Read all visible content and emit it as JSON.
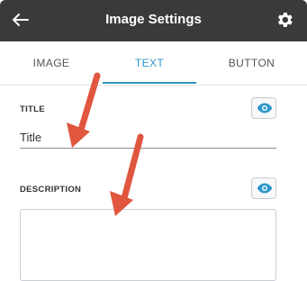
{
  "header": {
    "title": "Image Settings",
    "back_icon": "arrow-left-icon",
    "settings_icon": "gear-icon"
  },
  "tabs": [
    {
      "label": "IMAGE",
      "active": false
    },
    {
      "label": "TEXT",
      "active": true
    },
    {
      "label": "BUTTON",
      "active": false
    }
  ],
  "fields": {
    "title": {
      "label": "TITLE",
      "value": "Title",
      "visibility_icon": "eye-icon"
    },
    "description": {
      "label": "DESCRIPTION",
      "value": "",
      "visibility_icon": "eye-icon"
    }
  },
  "colors": {
    "header_bg": "#3a3a3c",
    "accent": "#2d96c9",
    "annotation_arrow": "#e0563f"
  }
}
